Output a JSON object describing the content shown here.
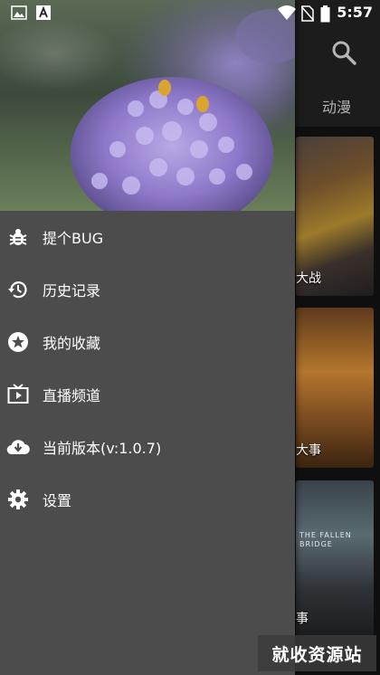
{
  "status_bar": {
    "time": "5:57",
    "icons": [
      "image-icon",
      "a-text-icon",
      "wifi-icon",
      "no-sim-icon",
      "battery-icon"
    ]
  },
  "app": {
    "tab_label": "动漫",
    "posters": [
      {
        "caption": "大战"
      },
      {
        "caption": "大事"
      },
      {
        "caption": "事",
        "title_text": "THE FALLEN BRIDGE"
      }
    ]
  },
  "drawer": {
    "menu": [
      {
        "label": "提个BUG",
        "icon": "bug-icon"
      },
      {
        "label": "历史记录",
        "icon": "history-icon"
      },
      {
        "label": "我的收藏",
        "icon": "star-icon"
      },
      {
        "label": "直播频道",
        "icon": "tv-icon"
      },
      {
        "label": "当前版本(v:1.0.7)",
        "icon": "cloud-download-icon"
      },
      {
        "label": "设置",
        "icon": "gear-icon"
      }
    ]
  },
  "watermark": {
    "text": "就收资源站"
  },
  "colors": {
    "drawer_bg": "#4c4c4c",
    "app_bg": "#0f0f0f",
    "text": "#ffffff"
  }
}
